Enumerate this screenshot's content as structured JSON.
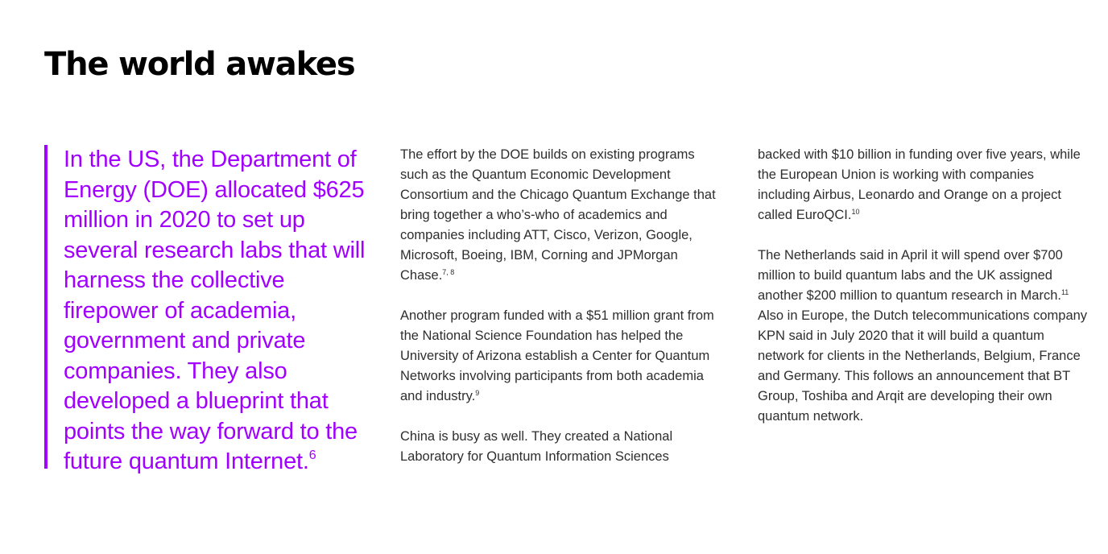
{
  "page": {
    "title": "The world awakes"
  },
  "pull_quote": {
    "text": "In the US, the Department of Energy (DOE) allocated $625 million in 2020 to set up several research labs that will harness the collective firepower of academia, government and private companies. They also developed a blueprint that points the way forward to the future quantum Internet.",
    "footnote": "6"
  },
  "column_2": {
    "paragraphs": [
      {
        "text": "The effort by the DOE builds on existing programs such as the Quantum Economic Development Consortium and the Chicago Quantum Exchange that bring together a who’s-who of academics and companies including ATT, Cisco, Verizon, Google, Microsoft, Boeing, IBM, Corning and JPMorgan Chase.",
        "footnote": "7, 8"
      },
      {
        "text": "Another program funded with a $51 million grant from the National Science Foundation has helped the University of Arizona establish a Center for Quantum Networks involving participants from both academia and industry.",
        "footnote": "9"
      },
      {
        "text": "China is busy as well. They created a National Laboratory for Quantum Information Sciences",
        "footnote": ""
      }
    ]
  },
  "column_3": {
    "paragraphs": [
      {
        "text": "backed with $10 billion in funding over five years, while the European Union is working with companies including Airbus, Leonardo and Orange on a project called EuroQCI.",
        "footnote": "10"
      },
      {
        "text_before": "The Netherlands said in April it will spend over $700 million to build quantum labs and the UK assigned another $200 million to quantum research in March.",
        "footnote": "11",
        "text_after": " Also in Europe, the Dutch telecommunications company KPN said in July 2020 that it will build a quantum network for clients in the Netherlands, Belgium, France and Germany. This follows an announcement that BT Group, Toshiba and Arqit are developing their own quantum network."
      }
    ]
  }
}
